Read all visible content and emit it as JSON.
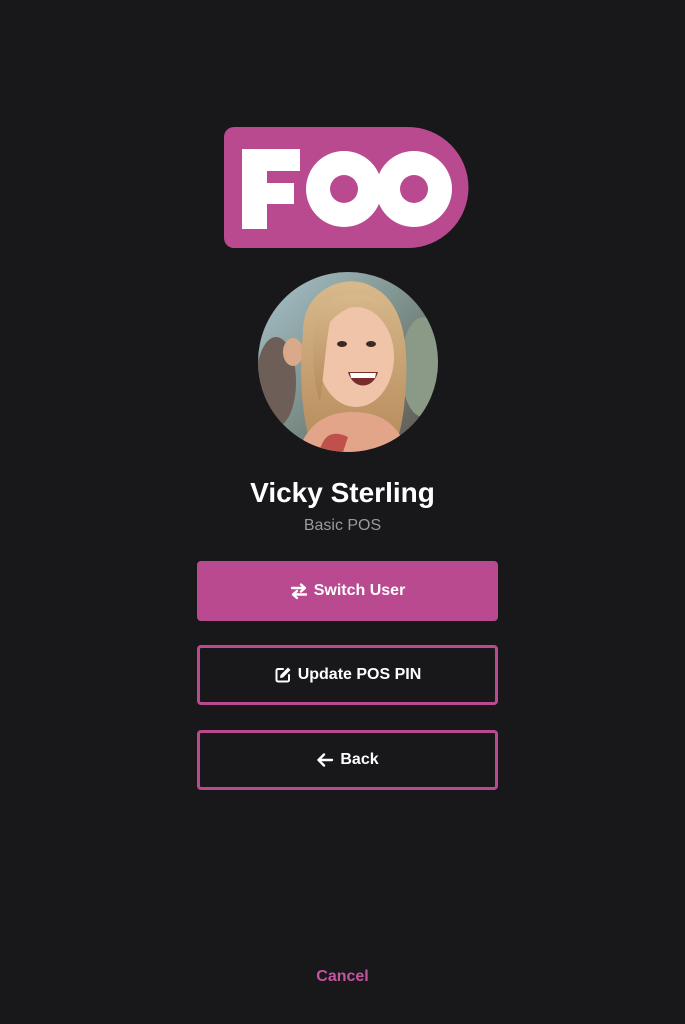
{
  "brand": {
    "logo_text": "FOO",
    "accent_color": "#b94a8f"
  },
  "user": {
    "name": "Vicky Sterling",
    "role": "Basic POS"
  },
  "actions": {
    "switch_user": {
      "label": "Switch User",
      "icon": "swap-arrows-icon"
    },
    "update_pin": {
      "label": "Update POS PIN",
      "icon": "edit-icon"
    },
    "back": {
      "label": "Back",
      "icon": "arrow-left-icon"
    }
  },
  "footer": {
    "cancel_label": "Cancel"
  }
}
